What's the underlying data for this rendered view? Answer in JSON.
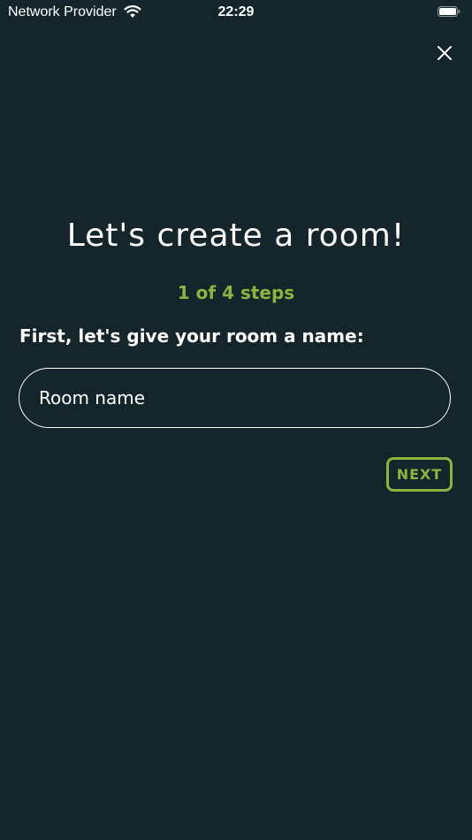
{
  "status_bar": {
    "carrier": "Network Provider",
    "time": "22:29",
    "wifi_icon": "wifi-icon",
    "battery_icon": "battery-icon"
  },
  "header": {
    "close_icon": "close-icon"
  },
  "main": {
    "title": "Let's create a room!",
    "steps": "1 of 4 steps",
    "prompt": "First, let's give your room a name:",
    "room_name_input": {
      "value": "",
      "placeholder": "Room name"
    },
    "next_label": "NEXT"
  },
  "colors": {
    "background": "#14262b",
    "accent": "#8db43c",
    "text": "#ffffff"
  }
}
